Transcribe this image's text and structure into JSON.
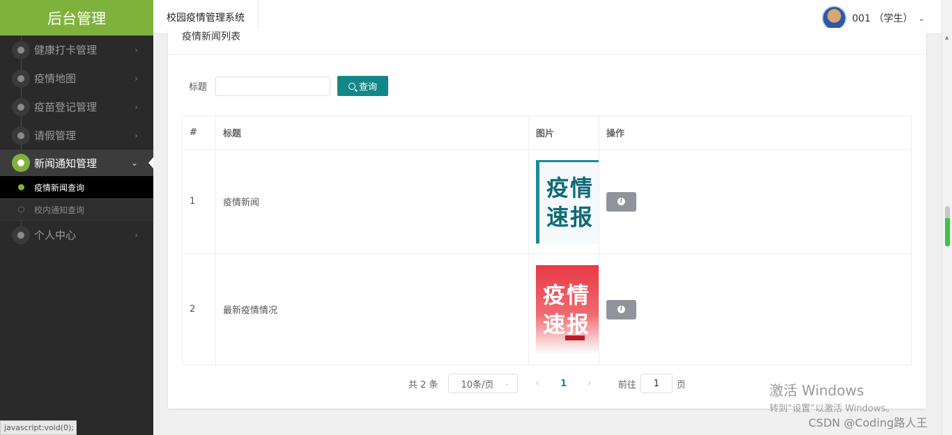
{
  "sidebar": {
    "brand": "后台管理",
    "items": [
      {
        "label": "健康打卡管理",
        "icon": "globe-icon"
      },
      {
        "label": "疫情地图",
        "icon": "globe-icon"
      },
      {
        "label": "疫苗登记管理",
        "icon": "globe-icon"
      },
      {
        "label": "请假管理",
        "icon": "globe-icon"
      },
      {
        "label": "新闻通知管理",
        "icon": "globe-icon",
        "active": true,
        "children": [
          {
            "label": "疫情新闻查询",
            "current": true
          },
          {
            "label": "校内通知查询"
          }
        ]
      },
      {
        "label": "个人中心",
        "icon": "globe-icon"
      }
    ]
  },
  "header": {
    "system_title": "校园疫情管理系统",
    "user": "001 （学生）"
  },
  "card": {
    "title": "疫情新闻列表",
    "search": {
      "label": "标题",
      "value": "",
      "button": "查询"
    },
    "table": {
      "columns": [
        "#",
        "标题",
        "图片",
        "操作"
      ],
      "rows": [
        {
          "index": "1",
          "title": "疫情新闻",
          "image_text": [
            "疫情",
            "速报"
          ],
          "image_style": "teal"
        },
        {
          "index": "2",
          "title": "最新疫情情况",
          "image_text": [
            "疫情",
            "速报"
          ],
          "image_style": "red"
        }
      ],
      "action_icon": "info-icon"
    },
    "pagination": {
      "total": "共 2 条",
      "page_size": "10条/页",
      "current_page": "1",
      "goto_prefix": "前往",
      "goto_value": "1",
      "goto_suffix": "页"
    }
  },
  "overlay": {
    "status_url": "javascript:void(0);",
    "watermark_title": "激活 Windows",
    "watermark_sub": "转到“设置”以激活 Windows。",
    "csdn": "CSDN @Coding路人王"
  },
  "colors": {
    "brand": "#7fb23c",
    "sidebar_bg": "#2a2a2a",
    "primary_button": "#138787",
    "info_button": "#909399"
  }
}
